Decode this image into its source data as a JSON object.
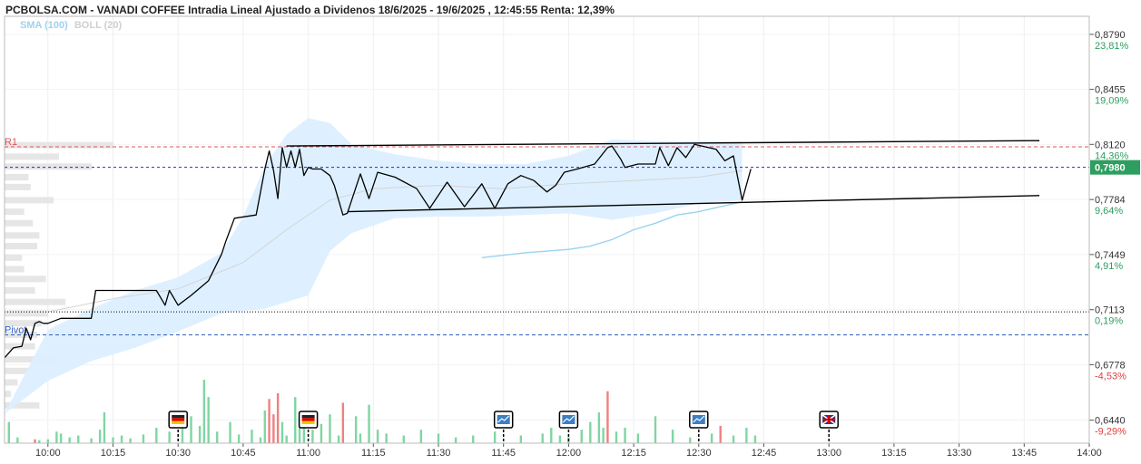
{
  "title": "PCBOLSA.COM - VANADI COFFEE Intradia Lineal Ajustado a Dividenos 18/6/2025 - 19/6/2025 , 12:45:55 Renta: 12,39%",
  "legend": {
    "sma": "SMA (100)",
    "boll": "BOLL (20)"
  },
  "colors": {
    "price": "#000000",
    "up_volume": "#7fd6a2",
    "down_volume": "#f08080",
    "band_fill": "#dcefff",
    "sma": "#99d3f0",
    "last_price_box": "#2e9e60",
    "r1": "#e05555",
    "pivot": "#3060c0"
  },
  "chart_data": {
    "type": "line",
    "x_axis": {
      "labels": [
        "10:00",
        "10:15",
        "10:30",
        "10:45",
        "11:00",
        "11:15",
        "11:30",
        "11:45",
        "12:00",
        "12:15",
        "12:30",
        "12:45",
        "13:00",
        "13:15",
        "13:30",
        "13:45",
        "14:00"
      ],
      "min": "09:50",
      "max": "14:00"
    },
    "y_axis": {
      "ylim": [
        0.63,
        0.89
      ],
      "ticks": [
        {
          "value": 0.879,
          "label": "0,8790",
          "pct": "23,81%"
        },
        {
          "value": 0.8455,
          "label": "0,8455",
          "pct": "19,09%"
        },
        {
          "value": 0.812,
          "label": "0,8120",
          "pct": "14,36%"
        },
        {
          "value": 0.7784,
          "label": "0,7784",
          "pct": "9,64%"
        },
        {
          "value": 0.7449,
          "label": "0,7449",
          "pct": "4,91%"
        },
        {
          "value": 0.7113,
          "label": "0,7113",
          "pct": "0,19%"
        },
        {
          "value": 0.6778,
          "label": "0,6778",
          "pct": "-4,53%"
        },
        {
          "value": 0.644,
          "label": "0,6440",
          "pct": "-9,29%"
        }
      ]
    },
    "last_price": {
      "value": 0.798,
      "label": "0,7980"
    },
    "levels": [
      {
        "name": "R1",
        "value": 0.8105
      },
      {
        "name": "Pivot",
        "value": 0.696
      },
      {
        "name": "",
        "value": 0.71
      },
      {
        "name": "",
        "value": 0.798
      }
    ],
    "price_series": [
      [
        "09:50",
        0.682
      ],
      [
        "09:52",
        0.688
      ],
      [
        "09:54",
        0.689
      ],
      [
        "09:55",
        0.7
      ],
      [
        "09:56",
        0.693
      ],
      [
        "09:57",
        0.703
      ],
      [
        "09:58",
        0.704
      ],
      [
        "09:59",
        0.703
      ],
      [
        "10:00",
        0.703
      ],
      [
        "10:03",
        0.706
      ],
      [
        "10:10",
        0.706
      ],
      [
        "10:11",
        0.723
      ],
      [
        "10:14",
        0.723
      ],
      [
        "10:20",
        0.723
      ],
      [
        "10:23",
        0.723
      ],
      [
        "10:25",
        0.723
      ],
      [
        "10:27",
        0.714
      ],
      [
        "10:28",
        0.723
      ],
      [
        "10:30",
        0.714
      ],
      [
        "10:33",
        0.72
      ],
      [
        "10:37",
        0.729
      ],
      [
        "10:40",
        0.745
      ],
      [
        "10:41",
        0.753
      ],
      [
        "10:43",
        0.767
      ],
      [
        "10:48",
        0.769
      ],
      [
        "10:50",
        0.797
      ],
      [
        "10:51",
        0.808
      ],
      [
        "10:52",
        0.796
      ],
      [
        "10:53",
        0.779
      ],
      [
        "10:54",
        0.81
      ],
      [
        "10:55",
        0.798
      ],
      [
        "10:56",
        0.808
      ],
      [
        "10:57",
        0.798
      ],
      [
        "10:58",
        0.809
      ],
      [
        "10:59",
        0.793
      ],
      [
        "11:00",
        0.798
      ],
      [
        "11:01",
        0.797
      ],
      [
        "11:03",
        0.797
      ],
      [
        "11:05",
        0.793
      ],
      [
        "11:06",
        0.787
      ],
      [
        "11:07",
        0.778
      ],
      [
        "11:08",
        0.769
      ],
      [
        "11:09",
        0.77
      ],
      [
        "11:12",
        0.794
      ],
      [
        "11:14",
        0.779
      ],
      [
        "11:16",
        0.795
      ],
      [
        "11:20",
        0.792
      ],
      [
        "11:25",
        0.785
      ],
      [
        "11:28",
        0.773
      ],
      [
        "11:32",
        0.789
      ],
      [
        "11:36",
        0.774
      ],
      [
        "11:40",
        0.788
      ],
      [
        "11:43",
        0.773
      ],
      [
        "11:46",
        0.788
      ],
      [
        "11:49",
        0.793
      ],
      [
        "11:52",
        0.79
      ],
      [
        "11:55",
        0.783
      ],
      [
        "11:57",
        0.787
      ],
      [
        "11:59",
        0.795
      ],
      [
        "12:02",
        0.797
      ],
      [
        "12:06",
        0.8
      ],
      [
        "12:09",
        0.81
      ],
      [
        "12:10",
        0.811
      ],
      [
        "12:12",
        0.803
      ],
      [
        "12:13",
        0.798
      ],
      [
        "12:16",
        0.8
      ],
      [
        "12:20",
        0.8
      ],
      [
        "12:21",
        0.81
      ],
      [
        "12:23",
        0.799
      ],
      [
        "12:25",
        0.81
      ],
      [
        "12:27",
        0.804
      ],
      [
        "12:29",
        0.812
      ],
      [
        "12:34",
        0.809
      ],
      [
        "12:36",
        0.802
      ],
      [
        "12:38",
        0.805
      ],
      [
        "12:40",
        0.778
      ],
      [
        "12:42",
        0.797
      ]
    ],
    "sma_series": [
      [
        "11:40",
        0.743
      ],
      [
        "11:50",
        0.746
      ],
      [
        "12:00",
        0.748
      ],
      [
        "12:05",
        0.75
      ],
      [
        "12:10",
        0.754
      ],
      [
        "12:15",
        0.76
      ],
      [
        "12:20",
        0.764
      ],
      [
        "12:25",
        0.769
      ],
      [
        "12:30",
        0.771
      ],
      [
        "12:35",
        0.774
      ],
      [
        "12:40",
        0.777
      ]
    ],
    "boll_upper": [
      [
        "09:50",
        0.648
      ],
      [
        "10:00",
        0.699
      ],
      [
        "10:10",
        0.712
      ],
      [
        "10:20",
        0.723
      ],
      [
        "10:30",
        0.731
      ],
      [
        "10:40",
        0.746
      ],
      [
        "10:45",
        0.768
      ],
      [
        "10:50",
        0.799
      ],
      [
        "10:55",
        0.818
      ],
      [
        "11:00",
        0.828
      ],
      [
        "11:05",
        0.825
      ],
      [
        "11:10",
        0.812
      ],
      [
        "11:20",
        0.806
      ],
      [
        "11:30",
        0.802
      ],
      [
        "11:40",
        0.8
      ],
      [
        "11:50",
        0.8
      ],
      [
        "12:00",
        0.805
      ],
      [
        "12:10",
        0.815
      ],
      [
        "12:20",
        0.814
      ],
      [
        "12:30",
        0.814
      ],
      [
        "12:40",
        0.814
      ]
    ],
    "boll_lower": [
      [
        "12:40",
        0.778
      ],
      [
        "12:30",
        0.776
      ],
      [
        "12:20",
        0.77
      ],
      [
        "12:10",
        0.766
      ],
      [
        "12:00",
        0.77
      ],
      [
        "11:50",
        0.769
      ],
      [
        "11:40",
        0.768
      ],
      [
        "11:30",
        0.768
      ],
      [
        "11:20",
        0.767
      ],
      [
        "11:10",
        0.758
      ],
      [
        "11:05",
        0.747
      ],
      [
        "11:00",
        0.72
      ],
      [
        "10:50",
        0.712
      ],
      [
        "10:40",
        0.709
      ],
      [
        "10:30",
        0.698
      ],
      [
        "10:20",
        0.688
      ],
      [
        "10:10",
        0.68
      ],
      [
        "10:00",
        0.668
      ],
      [
        "09:50",
        0.648
      ]
    ],
    "boll_mid": [
      [
        "10:00",
        0.71
      ],
      [
        "10:15",
        0.718
      ],
      [
        "10:30",
        0.724
      ],
      [
        "10:45",
        0.74
      ],
      [
        "10:55",
        0.76
      ],
      [
        "11:05",
        0.778
      ],
      [
        "11:15",
        0.785
      ],
      [
        "11:30",
        0.787
      ],
      [
        "11:45",
        0.785
      ],
      [
        "12:00",
        0.788
      ],
      [
        "12:15",
        0.79
      ],
      [
        "12:30",
        0.792
      ],
      [
        "12:40",
        0.796
      ]
    ],
    "trendlines": [
      [
        [
          "10:55",
          0.811
        ],
        [
          "14:00",
          0.815
        ]
      ],
      [
        [
          "11:09",
          0.771
        ],
        [
          "14:00",
          0.783
        ]
      ]
    ],
    "volume_max": 66,
    "volume": [
      [
        "09:51",
        22,
        "up"
      ],
      [
        "09:53",
        6,
        "up"
      ],
      [
        "09:57",
        4,
        "down"
      ],
      [
        "09:58",
        3,
        "up"
      ],
      [
        "10:00",
        4,
        "up"
      ],
      [
        "10:02",
        12,
        "up"
      ],
      [
        "10:03",
        10,
        "up"
      ],
      [
        "10:05",
        6,
        "up"
      ],
      [
        "10:07",
        8,
        "up"
      ],
      [
        "10:10",
        5,
        "up"
      ],
      [
        "10:12",
        14,
        "up"
      ],
      [
        "10:13",
        32,
        "up"
      ],
      [
        "10:15",
        6,
        "up"
      ],
      [
        "10:17",
        8,
        "up"
      ],
      [
        "10:19",
        5,
        "up"
      ],
      [
        "10:22",
        9,
        "up"
      ],
      [
        "10:25",
        16,
        "up"
      ],
      [
        "10:28",
        12,
        "up"
      ],
      [
        "10:31",
        22,
        "up"
      ],
      [
        "10:33",
        28,
        "up"
      ],
      [
        "10:35",
        18,
        "up"
      ],
      [
        "10:36",
        66,
        "up"
      ],
      [
        "10:37",
        48,
        "up"
      ],
      [
        "10:39",
        12,
        "up"
      ],
      [
        "10:42",
        22,
        "up"
      ],
      [
        "10:44",
        9,
        "up"
      ],
      [
        "10:47",
        14,
        "up"
      ],
      [
        "10:49",
        6,
        "up"
      ],
      [
        "10:50",
        34,
        "up"
      ],
      [
        "10:51",
        46,
        "down"
      ],
      [
        "10:52",
        30,
        "down"
      ],
      [
        "10:53",
        52,
        "down"
      ],
      [
        "10:54",
        22,
        "up"
      ],
      [
        "10:55",
        8,
        "up"
      ],
      [
        "10:57",
        48,
        "up"
      ],
      [
        "10:58",
        28,
        "up"
      ],
      [
        "10:59",
        18,
        "up"
      ],
      [
        "11:01",
        14,
        "up"
      ],
      [
        "11:03",
        20,
        "up"
      ],
      [
        "11:05",
        30,
        "up"
      ],
      [
        "11:07",
        8,
        "up"
      ],
      [
        "11:08",
        42,
        "down"
      ],
      [
        "11:11",
        28,
        "up"
      ],
      [
        "11:12",
        10,
        "up"
      ],
      [
        "11:14",
        40,
        "up"
      ],
      [
        "11:16",
        14,
        "up"
      ],
      [
        "11:18",
        10,
        "up"
      ],
      [
        "11:22",
        8,
        "up"
      ],
      [
        "11:26",
        14,
        "up"
      ],
      [
        "11:30",
        10,
        "up"
      ],
      [
        "11:34",
        6,
        "up"
      ],
      [
        "11:38",
        8,
        "up"
      ],
      [
        "11:43",
        12,
        "up"
      ],
      [
        "11:49",
        8,
        "up"
      ],
      [
        "11:54",
        10,
        "up"
      ],
      [
        "11:56",
        16,
        "up"
      ],
      [
        "11:58",
        8,
        "up"
      ],
      [
        "12:00",
        6,
        "up"
      ],
      [
        "12:03",
        14,
        "up"
      ],
      [
        "12:05",
        22,
        "up"
      ],
      [
        "12:07",
        32,
        "up"
      ],
      [
        "12:08",
        16,
        "up"
      ],
      [
        "12:09",
        54,
        "down"
      ],
      [
        "12:11",
        12,
        "up"
      ],
      [
        "12:13",
        16,
        "up"
      ],
      [
        "12:16",
        10,
        "up"
      ],
      [
        "12:20",
        28,
        "up"
      ],
      [
        "12:24",
        14,
        "up"
      ],
      [
        "12:28",
        6,
        "up"
      ],
      [
        "12:33",
        10,
        "up"
      ],
      [
        "12:35",
        18,
        "down"
      ],
      [
        "12:38",
        8,
        "up"
      ],
      [
        "12:41",
        16,
        "up"
      ],
      [
        "12:43",
        8,
        "up"
      ]
    ],
    "event_markers": [
      {
        "time": "10:30",
        "icon": "germany-flag-icon"
      },
      {
        "time": "11:00",
        "icon": "germany-flag-icon"
      },
      {
        "time": "11:45",
        "icon": "chart-report-icon"
      },
      {
        "time": "12:00",
        "icon": "chart-report-icon"
      },
      {
        "time": "12:30",
        "icon": "chart-report-icon"
      },
      {
        "time": "13:00",
        "icon": "uk-flag-icon"
      }
    ],
    "volume_profile": [
      {
        "price": 0.8115,
        "w": 1.0
      },
      {
        "price": 0.8045,
        "w": 0.5
      },
      {
        "price": 0.7985,
        "w": 0.8
      },
      {
        "price": 0.792,
        "w": 0.22
      },
      {
        "price": 0.786,
        "w": 0.24
      },
      {
        "price": 0.778,
        "w": 0.45
      },
      {
        "price": 0.771,
        "w": 0.18
      },
      {
        "price": 0.764,
        "w": 0.26
      },
      {
        "price": 0.7565,
        "w": 0.32
      },
      {
        "price": 0.75,
        "w": 0.3
      },
      {
        "price": 0.743,
        "w": 0.16
      },
      {
        "price": 0.736,
        "w": 0.18
      },
      {
        "price": 0.73,
        "w": 0.38
      },
      {
        "price": 0.723,
        "w": 0.28
      },
      {
        "price": 0.716,
        "w": 0.56
      },
      {
        "price": 0.709,
        "w": 0.4
      },
      {
        "price": 0.703,
        "w": 0.34
      },
      {
        "price": 0.696,
        "w": 0.3
      },
      {
        "price": 0.689,
        "w": 0.28
      },
      {
        "price": 0.681,
        "w": 0.5
      },
      {
        "price": 0.674,
        "w": 0.3
      },
      {
        "price": 0.667,
        "w": 0.12
      },
      {
        "price": 0.66,
        "w": 0.06
      },
      {
        "price": 0.653,
        "w": 0.32
      }
    ]
  }
}
